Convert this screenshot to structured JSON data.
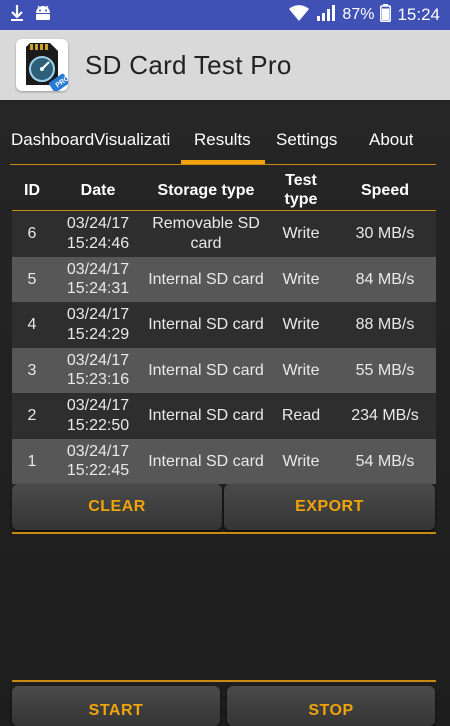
{
  "status_bar": {
    "battery_percent": "87%",
    "time": "15:24",
    "icons": [
      "download-icon",
      "android-icon",
      "wifi-icon",
      "signal-icon",
      "battery-icon"
    ]
  },
  "app_bar": {
    "title": "SD Card Test Pro",
    "icon": "sd-card-speedometer-icon"
  },
  "tabs": [
    {
      "label": "Dashboard"
    },
    {
      "label": "Visualizati"
    },
    {
      "label": "Results",
      "active": true
    },
    {
      "label": "Settings"
    },
    {
      "label": "About"
    }
  ],
  "table": {
    "headers": {
      "id": "ID",
      "date": "Date",
      "storage": "Storage type",
      "test_type": "Test type",
      "speed": "Speed"
    },
    "rows": [
      {
        "id": "6",
        "date": "03/24/17 15:24:46",
        "storage": "Removable SD card",
        "type": "Write",
        "speed": "30 MB/s"
      },
      {
        "id": "5",
        "date": "03/24/17 15:24:31",
        "storage": "Internal SD card",
        "type": "Write",
        "speed": "84 MB/s"
      },
      {
        "id": "4",
        "date": "03/24/17 15:24:29",
        "storage": "Internal SD card",
        "type": "Write",
        "speed": "88 MB/s"
      },
      {
        "id": "3",
        "date": "03/24/17 15:23:16",
        "storage": "Internal SD card",
        "type": "Write",
        "speed": "55 MB/s"
      },
      {
        "id": "2",
        "date": "03/24/17 15:22:50",
        "storage": "Internal SD card",
        "type": "Read",
        "speed": "234 MB/s"
      },
      {
        "id": "1",
        "date": "03/24/17 15:22:45",
        "storage": "Internal SD card",
        "type": "Write",
        "speed": "54 MB/s"
      }
    ]
  },
  "buttons": {
    "clear": "CLEAR",
    "export": "EXPORT",
    "start": "START",
    "stop": "STOP"
  },
  "colors": {
    "accent": "#f0a30a",
    "status_bar": "#3f51b5",
    "app_bar": "#d9d9d9",
    "background": "#1e1e1e"
  }
}
